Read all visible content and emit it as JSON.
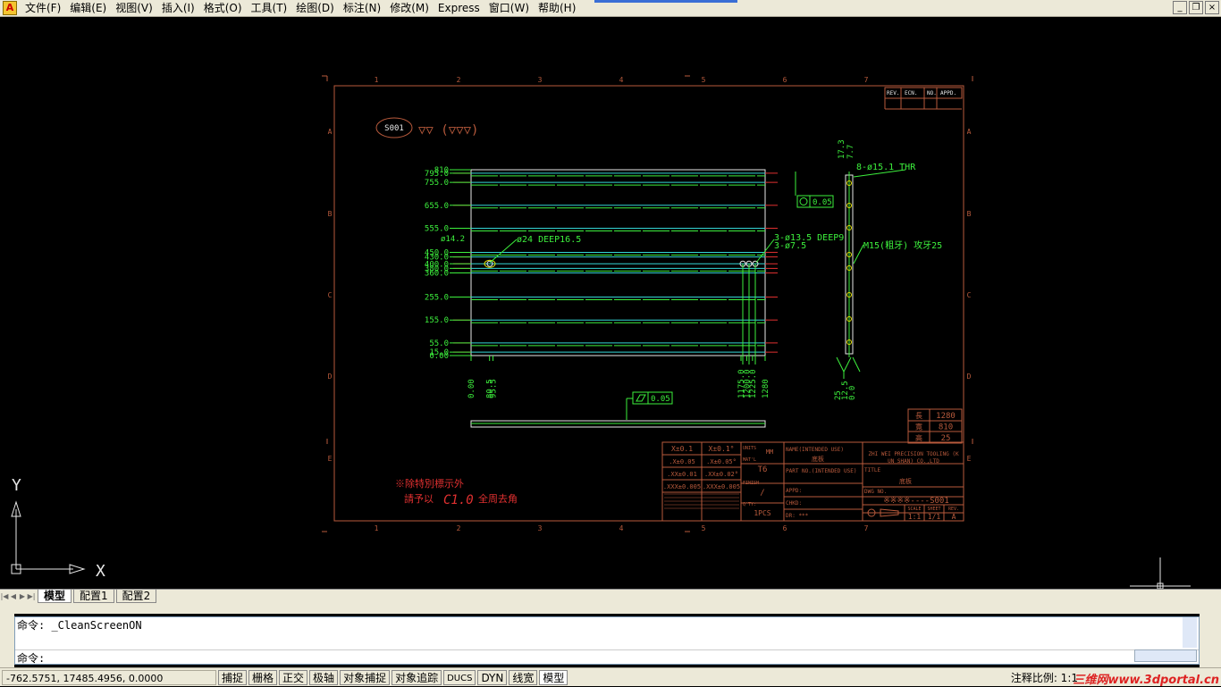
{
  "app": {
    "icon": "autocad-logo-icon"
  },
  "menu": [
    "文件(F)",
    "编辑(E)",
    "视图(V)",
    "插入(I)",
    "格式(O)",
    "工具(T)",
    "绘图(D)",
    "标注(N)",
    "修改(M)",
    "Express",
    "窗口(W)",
    "帮助(H)"
  ],
  "window_controls": {
    "minimize": "_",
    "restore": "❐",
    "close": "×"
  },
  "drawing": {
    "part_no": "S001",
    "grid_cols": [
      "1",
      "2",
      "3",
      "4",
      "5",
      "6",
      "7"
    ],
    "grid_rows": [
      "A",
      "B",
      "C",
      "D",
      "E"
    ],
    "rev_headers": [
      "REV.",
      "ECN.",
      "NO.",
      "APPD."
    ],
    "dim_left": [
      "810",
      "795.0",
      "755.0",
      "655.0",
      "555.0",
      "450.0",
      "430.0",
      "400.0",
      "380.0",
      "360.0",
      "255.0",
      "155.0",
      "55.0",
      "15.0",
      "0.00"
    ],
    "dim_bottom": [
      "0.00",
      "80.5",
      "95.5",
      "1175.0",
      "1200.0",
      "1225.0",
      "1280"
    ],
    "note_hole1": "ø14.2",
    "note_hole2": "ø24 DEEP16.5",
    "note_hole3": "3-ø13.5 DEEP9",
    "note_hole4": "3-ø7.5",
    "side_top": [
      "17.3",
      "7.7"
    ],
    "side_note1": "8-ø15.1 THR",
    "side_note2": "M15(粗牙) 攻牙25",
    "side_bottom": [
      "25",
      "12.5",
      "0.0"
    ],
    "flatness": "0.05",
    "tol_box": "0.05",
    "dims_table": [
      {
        "k": "長",
        "v": "1280"
      },
      {
        "k": "寬",
        "v": "810"
      },
      {
        "k": "高",
        "v": "25"
      }
    ],
    "notes_title": "※除特別標示外",
    "notes_body": "請予以",
    "notes_chamfer": "C1.0",
    "notes_tail": "全周去角",
    "tb": {
      "t1": "X±0.1",
      "t2": "X±0.1°",
      "t3": ".X±0.05",
      "t4": ".X±0.05°",
      "t5": ".XX±0.01",
      "t6": ".XX±0.02°",
      "t7": ".XXX±0.005",
      "t8": ".XXX±0.005",
      "units_l": "UNITS",
      "units": "MM",
      "matl_l": "MAT'L",
      "matl": "T6",
      "finish_l": "FINISH",
      "finish": "/",
      "qty_l": "Q'TY:",
      "qty": "1PCS",
      "name_l": "NAME(INTENDED USE)",
      "name": "底板",
      "partno_l": "PART NO.(INTENDED USE)",
      "appd": "APPD:",
      "chkd": "CHKD:",
      "dr": "DR: ***",
      "company": "ZHI  WEI  PRECISION TOOLING (KUN SHAN) CO.,LTD",
      "title_l": "TITLE",
      "title": "底板",
      "dwg_l": "DWG NO.",
      "dwg": "※※※※----S001",
      "scale_l": "SCALE",
      "sheet_l": "SHEET",
      "rev_l": "REV.",
      "scale": "1:1",
      "sheet": "1/1",
      "rev": "A"
    },
    "ucs": {
      "x": "X",
      "y": "Y"
    }
  },
  "tabs": [
    "模型",
    "配置1",
    "配置2"
  ],
  "command": {
    "line1": "命令: _CleanScreenON",
    "line2": "命令:"
  },
  "status": {
    "coords": "-762.5751,  17485.4956, 0.0000",
    "buttons": [
      "捕捉",
      "栅格",
      "正交",
      "极轴",
      "对象捕捉",
      "对象追踪",
      "DUCS",
      "DYN",
      "线宽",
      "模型"
    ],
    "annotation": "注释比例: 1:1",
    "watermark": "三维网www.3dportal.cn"
  },
  "colors": {
    "frame": "#b85a3c",
    "green": "#3df03d",
    "cyan": "#34d6d6",
    "red": "#e03030",
    "white": "#e8e8e8",
    "yellow": "#e0e000",
    "bg": "#000000"
  }
}
